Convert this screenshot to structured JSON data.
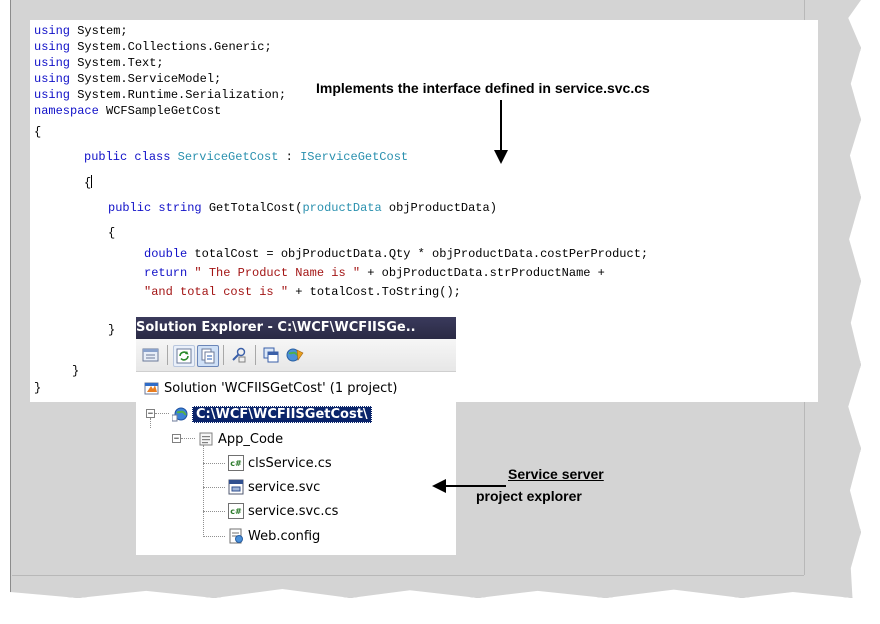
{
  "code": {
    "line1": {
      "kw": "using",
      "rest": " System;"
    },
    "line2": {
      "kw": "using",
      "rest": " System.Collections.Generic;"
    },
    "line3": {
      "kw": "using",
      "rest": " System.Text;"
    },
    "line4": {
      "kw": "using",
      "rest": " System.ServiceModel;"
    },
    "line5": {
      "kw": "using",
      "rest": " System.Runtime.Serialization;"
    },
    "line6": {
      "kw": "namespace",
      "rest": " WCFSampleGetCost"
    },
    "line7": "{",
    "line8": {
      "kw1": "public",
      "kw2": "class",
      "type1": "ServiceGetCost",
      "colon": " : ",
      "type2": "IServiceGetCost"
    },
    "line9": "{",
    "line10": {
      "kw1": "public",
      "kw2": "string",
      "rest1": " GetTotalCost(",
      "type": "productData",
      "rest2": " objProductData)"
    },
    "line11": "{",
    "line12": {
      "kw": "double",
      "rest": " totalCost = objProductData.Qty * objProductData.costPerProduct;"
    },
    "line13": {
      "kw": "return",
      "str": " \" The Product Name is \"",
      "rest": " + objProductData.strProductName +"
    },
    "line14": {
      "str": "\"and total cost is \"",
      "rest": " + totalCost.ToString();"
    },
    "line15": "}",
    "line16": "}",
    "line17": "}"
  },
  "annotations": {
    "interface_note": "Implements the interface defined in service.svc.cs",
    "explorer_note_line1": "Service server",
    "explorer_note_line2": "project explorer"
  },
  "solution_explorer": {
    "title": "Solution Explorer - C:\\WCF\\WCFIISGe..",
    "toolbar_icons": [
      "properties-icon",
      "refresh-icon",
      "show-all-files-icon",
      "nest-related-files-icon",
      "copy-web-site-icon",
      "asp-net-configuration-icon"
    ],
    "tree": {
      "solution": "Solution 'WCFIISGetCost' (1 project)",
      "project": "C:\\WCF\\WCFIISGetCost\\",
      "folder": "App_Code",
      "files": [
        {
          "name": "clsService.cs",
          "icon": "csharp-file-icon"
        },
        {
          "name": "service.svc",
          "icon": "svc-file-icon"
        },
        {
          "name": "service.svc.cs",
          "icon": "csharp-file-icon"
        },
        {
          "name": "Web.config",
          "icon": "config-file-icon"
        }
      ]
    }
  },
  "colors": {
    "keyword": "#1010c8",
    "type": "#2b91af",
    "string": "#a31515",
    "selection": "#0a246a",
    "background": "#d4d4d4"
  }
}
